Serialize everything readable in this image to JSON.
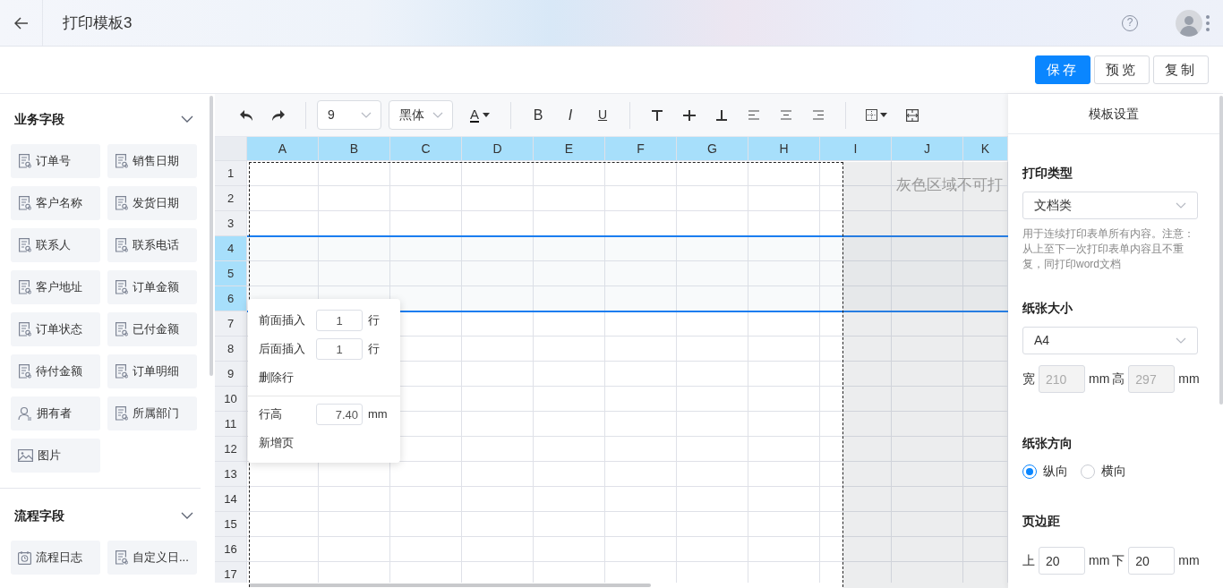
{
  "app_bar": {
    "title": "打印模板3",
    "help": "?"
  },
  "actions": [
    {
      "label": "保存",
      "kind": "primary"
    },
    {
      "label": "预览",
      "kind": "default"
    },
    {
      "label": "复制",
      "kind": "default"
    }
  ],
  "field_groups": [
    {
      "title": "业务字段",
      "expanded": true,
      "fields": [
        {
          "label": "订单号",
          "kind": "field"
        },
        {
          "label": "销售日期",
          "kind": "field"
        },
        {
          "label": "客户名称",
          "kind": "field"
        },
        {
          "label": "发货日期",
          "kind": "field"
        },
        {
          "label": "联系人",
          "kind": "field"
        },
        {
          "label": "联系电话",
          "kind": "field"
        },
        {
          "label": "客户地址",
          "kind": "field"
        },
        {
          "label": "订单金额",
          "kind": "field"
        },
        {
          "label": "订单状态",
          "kind": "field"
        },
        {
          "label": "已付金额",
          "kind": "field"
        },
        {
          "label": "待付金额",
          "kind": "field"
        },
        {
          "label": "订单明细",
          "kind": "field"
        },
        {
          "label": "拥有者",
          "kind": "user"
        },
        {
          "label": "所属部门",
          "kind": "field"
        },
        {
          "label": "图片",
          "kind": "image"
        }
      ]
    },
    {
      "title": "流程字段",
      "expanded": true,
      "fields": [
        {
          "label": "流程日志",
          "kind": "log"
        },
        {
          "label": "自定义日...",
          "kind": "field"
        }
      ]
    }
  ],
  "toolbar": {
    "font_size": "9",
    "font_family": "黑体",
    "font_color": "A",
    "bold": "B",
    "italic": "I",
    "underline": "U"
  },
  "sheet": {
    "columns": [
      "A",
      "B",
      "C",
      "D",
      "E",
      "F",
      "G",
      "H",
      "I",
      "J",
      "K"
    ],
    "rows": [
      {
        "label": "1",
        "selected": false
      },
      {
        "label": "2",
        "selected": false
      },
      {
        "label": "3",
        "selected": false
      },
      {
        "label": "4",
        "selected": true
      },
      {
        "label": "5",
        "selected": true
      },
      {
        "label": "6",
        "selected": true
      },
      {
        "label": "7",
        "selected": false
      },
      {
        "label": "8",
        "selected": false
      },
      {
        "label": "9",
        "selected": false
      },
      {
        "label": "10",
        "selected": false
      },
      {
        "label": "11",
        "selected": false
      },
      {
        "label": "12",
        "selected": false
      },
      {
        "label": "13",
        "selected": false
      },
      {
        "label": "14",
        "selected": false
      },
      {
        "label": "15",
        "selected": false
      },
      {
        "label": "16",
        "selected": false
      },
      {
        "label": "17",
        "selected": false
      }
    ],
    "non_print_note": "灰色区域不可打"
  },
  "row_menu": {
    "insert_before": {
      "label": "前面插入",
      "value": "1",
      "unit": "行"
    },
    "insert_after": {
      "label": "后面插入",
      "value": "1",
      "unit": "行"
    },
    "delete": "删除行",
    "row_height": {
      "label": "行高",
      "value": "7.40",
      "unit": "mm"
    },
    "new_page": "新增页"
  },
  "settings": {
    "title": "模板设置",
    "print_type": {
      "label": "打印类型",
      "value": "文档类",
      "hint": "用于连续打印表单所有内容。注意：从上至下一次打印表单内容且不重复，同打印word文档"
    },
    "paper_size": {
      "label": "纸张大小",
      "value": "A4",
      "fields": [
        {
          "label": "宽",
          "value": "210",
          "unit": "mm",
          "disabled": true
        },
        {
          "label": "高",
          "value": "297",
          "unit": "mm",
          "disabled": true
        }
      ]
    },
    "orientation": {
      "label": "纸张方向",
      "options": [
        {
          "label": "纵向",
          "selected": true
        },
        {
          "label": "横向",
          "selected": false
        }
      ]
    },
    "margins": {
      "label": "页边距",
      "fields": [
        {
          "label": "上",
          "value": "20",
          "unit": "mm",
          "disabled": false
        },
        {
          "label": "下",
          "value": "20",
          "unit": "mm",
          "disabled": false
        }
      ]
    }
  }
}
